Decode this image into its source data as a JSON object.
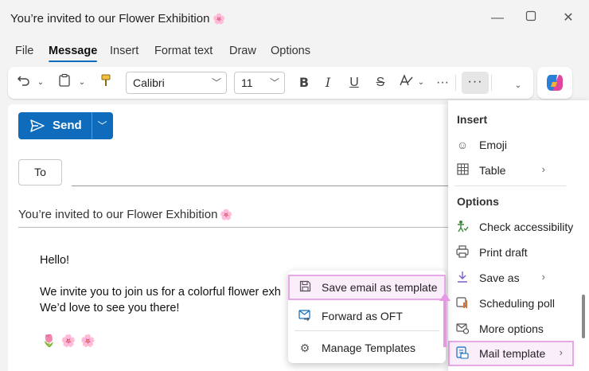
{
  "window": {
    "title": "You’re invited to our Flower Exhibition",
    "title_emoji": "🌸"
  },
  "menu_tabs": [
    "File",
    "Message",
    "Insert",
    "Format text",
    "Draw",
    "Options"
  ],
  "ribbon": {
    "font_name": "Calibri",
    "font_size": "11",
    "more": "···"
  },
  "compose": {
    "send_label": "Send",
    "to_label": "To",
    "subject": "You’re invited to our Flower Exhibition",
    "subject_emoji": "🌸",
    "body": {
      "greeting": "Hello!",
      "line1": "We invite you to join us for a colorful flower exh",
      "line2": "We’d love to see you there!",
      "emojis": "🌷🌸🌸"
    }
  },
  "overflow_menu": {
    "insert_header": "Insert",
    "emoji": "Emoji",
    "table": "Table",
    "options_header": "Options",
    "check_accessibility": "Check accessibility",
    "print_draft": "Print draft",
    "save_as": "Save as",
    "scheduling_poll": "Scheduling poll",
    "more_options": "More options",
    "mail_template": "Mail template"
  },
  "submenu": {
    "save_template": "Save email as template",
    "forward_oft": "Forward as OFT",
    "manage_templates": "Manage Templates"
  },
  "colors": {
    "accent": "#0f6cbd",
    "highlight": "#e6a8e6"
  }
}
